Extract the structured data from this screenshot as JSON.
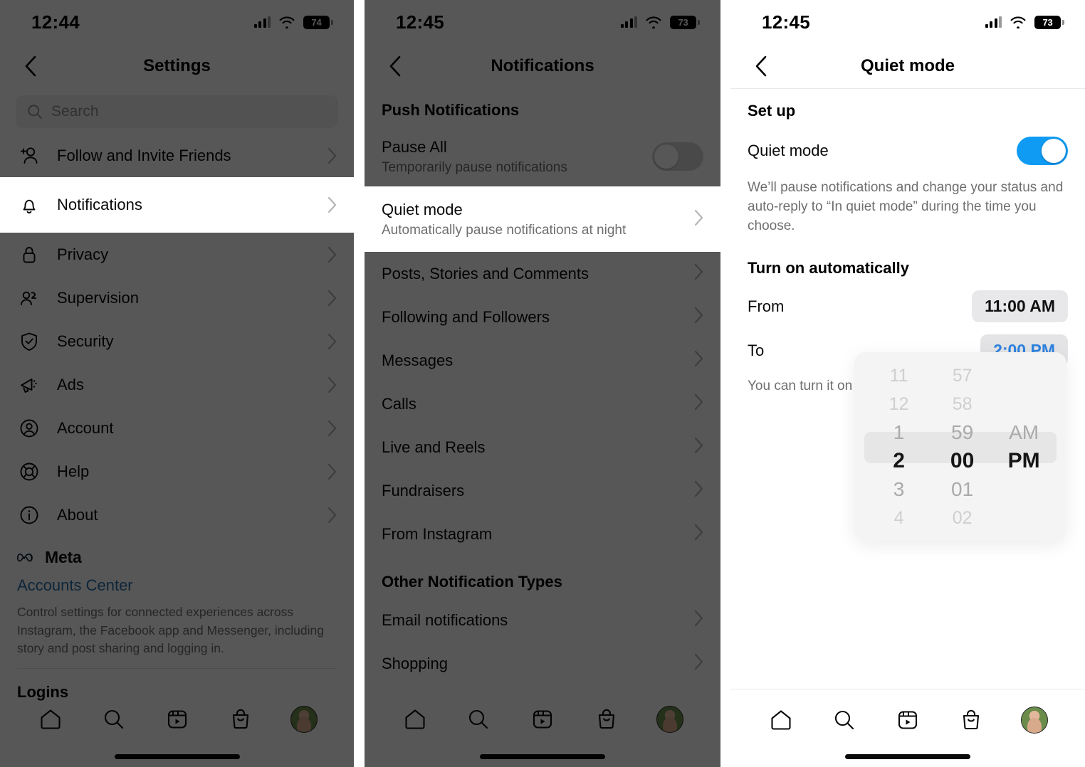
{
  "panels": {
    "settings": {
      "statusbar": {
        "time": "12:44",
        "battery": "74"
      },
      "nav": {
        "title": "Settings",
        "back_icon": "chevron-left-icon"
      },
      "search": {
        "placeholder": "Search",
        "icon": "search-icon"
      },
      "items": [
        {
          "label": "Follow and Invite Friends",
          "icon": "add-person-icon",
          "highlighted": false
        },
        {
          "label": "Notifications",
          "icon": "bell-icon",
          "highlighted": true
        },
        {
          "label": "Privacy",
          "icon": "lock-icon",
          "highlighted": false
        },
        {
          "label": "Supervision",
          "icon": "people-icon",
          "highlighted": false
        },
        {
          "label": "Security",
          "icon": "shield-check-icon",
          "highlighted": false
        },
        {
          "label": "Ads",
          "icon": "megaphone-icon",
          "highlighted": false
        },
        {
          "label": "Account",
          "icon": "account-circle-icon",
          "highlighted": false
        },
        {
          "label": "Help",
          "icon": "lifebuoy-icon",
          "highlighted": false
        },
        {
          "label": "About",
          "icon": "info-circle-icon",
          "highlighted": false
        }
      ],
      "meta": {
        "brand": "Meta",
        "logo_icon": "meta-infinity-icon",
        "link": "Accounts Center",
        "link_color": "#2a6ea8",
        "description": "Control settings for connected experiences across Instagram, the Facebook app and Messenger, including story and post sharing and logging in."
      },
      "logins_header": "Logins"
    },
    "notifications": {
      "statusbar": {
        "time": "12:45",
        "battery": "73"
      },
      "nav": {
        "title": "Notifications",
        "back_icon": "chevron-left-icon"
      },
      "push_header": "Push Notifications",
      "pause_all": {
        "title": "Pause All",
        "subtitle": "Temporarily pause notifications",
        "toggle_on": false
      },
      "quiet_mode": {
        "title": "Quiet mode",
        "subtitle": "Automatically pause notifications at night",
        "highlighted": true
      },
      "items": [
        {
          "label": "Posts, Stories and Comments"
        },
        {
          "label": "Following and Followers"
        },
        {
          "label": "Messages"
        },
        {
          "label": "Calls"
        },
        {
          "label": "Live and Reels"
        },
        {
          "label": "Fundraisers"
        },
        {
          "label": "From Instagram"
        }
      ],
      "other_header": "Other Notification Types",
      "other_items": [
        {
          "label": "Email notifications"
        },
        {
          "label": "Shopping"
        }
      ]
    },
    "quietmode": {
      "statusbar": {
        "time": "12:45",
        "battery": "73"
      },
      "nav": {
        "title": "Quiet mode",
        "back_icon": "chevron-left-icon"
      },
      "setup_header": "Set up",
      "toggle_row": {
        "label": "Quiet mode",
        "toggle_on": true,
        "toggle_color": "#0f9bf3"
      },
      "description": "We’ll pause notifications and change your status and auto-reply to “In quiet mode” during the time you choose.",
      "auto_header": "Turn on automatically",
      "from": {
        "label": "From",
        "value": "11:00 AM",
        "active": false
      },
      "to": {
        "label": "To",
        "value": "2:00 PM",
        "active": true
      },
      "hint": "You can turn it on for",
      "picker": {
        "hours": {
          "above2": "11",
          "above1": "12",
          "prev": "1",
          "selected": "2",
          "next": "3",
          "below2": "4"
        },
        "minutes": {
          "above2": "57",
          "above1": "58",
          "prev": "59",
          "selected": "00",
          "next": "01",
          "below2": "02"
        },
        "periods": {
          "prev": "AM",
          "selected": "PM"
        }
      }
    }
  },
  "tabbar": {
    "items": [
      {
        "name": "home",
        "icon": "home-icon"
      },
      {
        "name": "search",
        "icon": "search-icon"
      },
      {
        "name": "reels",
        "icon": "reels-icon"
      },
      {
        "name": "shop",
        "icon": "shop-bag-icon"
      },
      {
        "name": "profile",
        "icon": "avatar-icon"
      }
    ]
  }
}
